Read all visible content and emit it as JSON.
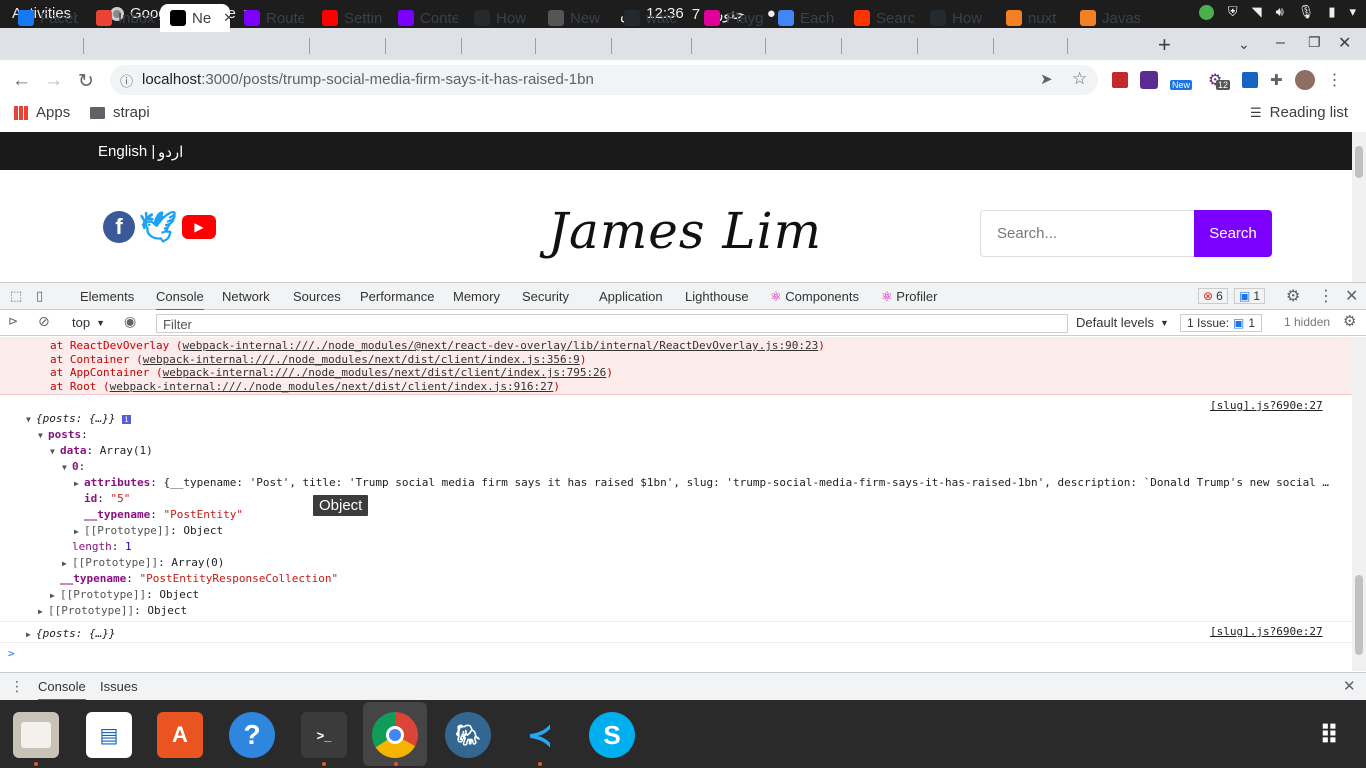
{
  "system": {
    "activities": "Activities",
    "app_name": "Google Chrome",
    "date": "جنوری 7",
    "time": "12:36",
    "ampm": "ص"
  },
  "tabs": [
    {
      "label": "Faceb",
      "color": "#1877f2"
    },
    {
      "label": "Inbox",
      "color": "#ea4335"
    },
    {
      "label": "Ne",
      "color": "#000000",
      "active": true
    },
    {
      "label": "Route",
      "color": "#7b00ff"
    },
    {
      "label": "Settin",
      "color": "#ff0000"
    },
    {
      "label": "Conte",
      "color": "#7b00ff"
    },
    {
      "label": "How",
      "color": "#24292e"
    },
    {
      "label": "New",
      "color": "#555555"
    },
    {
      "label": "watc",
      "color": "#24292e"
    },
    {
      "label": "Playg",
      "color": "#e10098"
    },
    {
      "label": "Each",
      "color": "#4285f4"
    },
    {
      "label": "Searc",
      "color": "#ff3300"
    },
    {
      "label": "How",
      "color": "#24292e"
    },
    {
      "label": "nuxt",
      "color": "#f48024"
    },
    {
      "label": "Javas",
      "color": "#f48024"
    }
  ],
  "address": {
    "host": "localhost",
    "path": ":3000/posts/trump-social-media-firm-says-it-has-raised-1bn"
  },
  "extensions": {
    "new_badge": "New",
    "count_badge": "12"
  },
  "bookmarks": {
    "apps": "Apps",
    "folder": "strapi",
    "reading_list": "Reading list"
  },
  "site": {
    "lang_en": "English |",
    "lang_ur": "اردو",
    "logo": "James Lim",
    "search_placeholder": "Search...",
    "search_button": "Search"
  },
  "devtools": {
    "tabs": [
      "Elements",
      "Console",
      "Network",
      "Sources",
      "Performance",
      "Memory",
      "Security",
      "Application",
      "Lighthouse",
      "Components",
      "Profiler"
    ],
    "error_count": "6",
    "message_count": "1",
    "context": "top",
    "filter_placeholder": "Filter",
    "levels": "Default levels",
    "issues": "1 Issue:",
    "issues_count": "1",
    "hidden": "1 hidden",
    "drawer_tabs": [
      "Console",
      "Issues"
    ],
    "tooltip": "Object"
  },
  "console": {
    "stack": [
      {
        "prefix": "at ReactDevOverlay (",
        "link": "webpack-internal:///./node_modules/@next/react-dev-overlay/lib/internal/ReactDevOverlay.js:90:23",
        "suffix": ")"
      },
      {
        "prefix": "at Container (",
        "link": "webpack-internal:///./node_modules/next/dist/client/index.js:356:9",
        "suffix": ")"
      },
      {
        "prefix": "at AppContainer (",
        "link": "webpack-internal:///./node_modules/next/dist/client/index.js:795:26",
        "suffix": ")"
      },
      {
        "prefix": "at Root (",
        "link": "webpack-internal:///./node_modules/next/dist/client/index.js:916:27",
        "suffix": ")"
      }
    ],
    "source": "[slug].js?690e:27",
    "obj_summary": "{posts: {…}}",
    "posts_key": "posts",
    "data_key": "data",
    "data_val": "Array(1)",
    "index0": "0",
    "attributes_key": "attributes",
    "attributes_preview": "{__typename: 'Post', title: 'Trump social media firm says it has raised $1bn', slug: 'trump-social-media-firm-says-it-has-raised-1bn', description: `Donald Trump's new social …",
    "id_key": "id",
    "id_val": "\"5\"",
    "typename_key": "__typename",
    "typename_val": "\"PostEntity\"",
    "proto_key": "[[Prototype]]",
    "proto_object": "Object",
    "length_key": "length",
    "length_val": "1",
    "proto_array": "Array(0)",
    "coll_typename_val": "\"PostEntityResponseCollection\"",
    "prompt": ">"
  }
}
